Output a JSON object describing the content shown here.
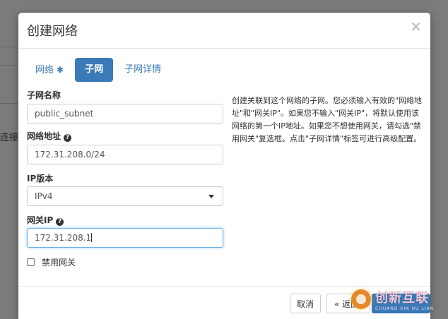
{
  "background": {
    "partial_text": "连接的"
  },
  "modal": {
    "title": "创建网络",
    "close_symbol": "×",
    "tabs": [
      {
        "label": "网络",
        "required_mark": "✱",
        "active": false
      },
      {
        "label": "子网",
        "active": true
      },
      {
        "label": "子网详情",
        "active": false
      }
    ],
    "fields": {
      "subnet_name": {
        "label": "子网名称",
        "value": "public_subnet"
      },
      "network_address": {
        "label": "网络地址",
        "help": "?",
        "value": "172.31.208.0/24"
      },
      "ip_version": {
        "label": "IP版本",
        "value": "IPv4"
      },
      "gateway_ip": {
        "label": "网关IP",
        "help": "?",
        "value": "172.31.208.1"
      }
    },
    "disable_gateway": {
      "label": "禁用网关",
      "checked": false
    },
    "help_text": "创建关联到这个网络的子网。您必须输入有效的\"网络地址\"和\"网关IP\"。如果您不输入\"网关IP\"，将默认使用该网络的第一个IP地址。如果您不想使用网关，请勾选\"禁用网关\"复选框。点击\"子网详情\"标签可进行高级配置。",
    "footer": {
      "cancel_label": "取消",
      "back_label": "« 返回"
    }
  },
  "watermark": {
    "brand_cn": "创新互联",
    "brand_en": "CHUANG XIN HU LIAN"
  },
  "colors": {
    "accent": "#3a7ab8",
    "backdrop": "#7b7b7b"
  }
}
